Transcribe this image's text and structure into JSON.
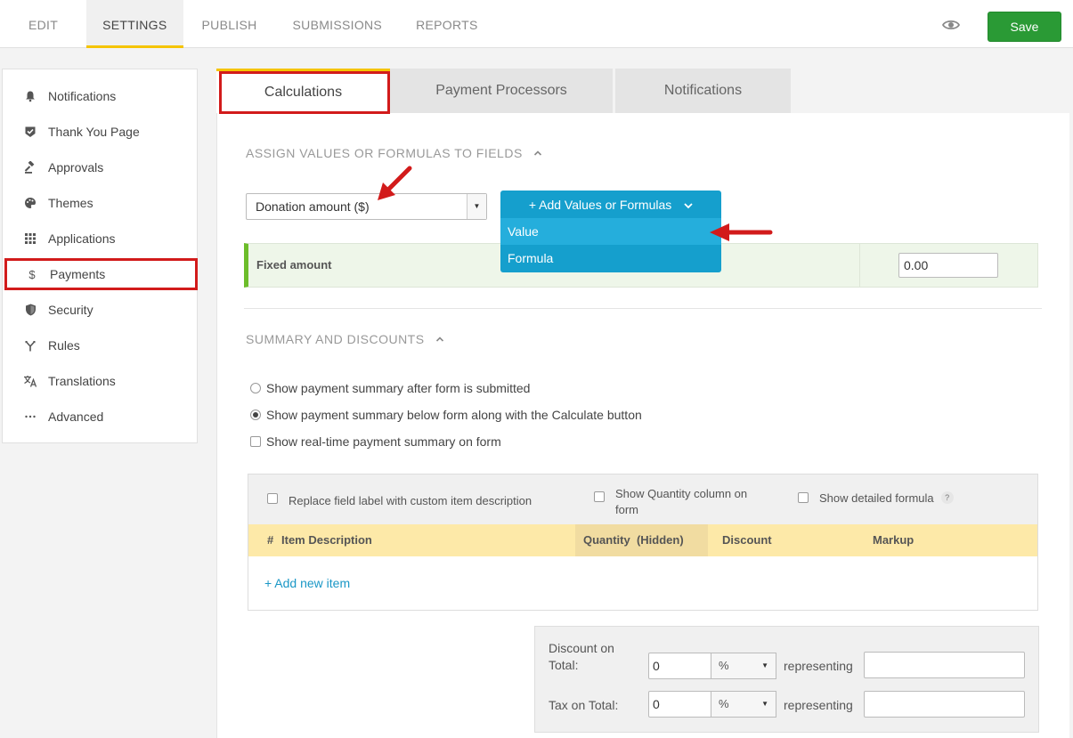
{
  "topnav": {
    "tabs": [
      "EDIT",
      "SETTINGS",
      "PUBLISH",
      "SUBMISSIONS",
      "REPORTS"
    ],
    "active_tab": "SETTINGS",
    "save_label": "Save"
  },
  "sidebar": {
    "items": [
      {
        "label": "Notifications",
        "icon": "bell-icon"
      },
      {
        "label": "Thank You Page",
        "icon": "badge-check-icon"
      },
      {
        "label": "Approvals",
        "icon": "gavel-icon"
      },
      {
        "label": "Themes",
        "icon": "palette-icon"
      },
      {
        "label": "Applications",
        "icon": "grid-icon"
      },
      {
        "label": "Payments",
        "icon": "dollar-icon"
      },
      {
        "label": "Security",
        "icon": "shield-icon"
      },
      {
        "label": "Rules",
        "icon": "fork-icon"
      },
      {
        "label": "Translations",
        "icon": "translate-icon"
      },
      {
        "label": "Advanced",
        "icon": "ellipsis-icon"
      }
    ],
    "active_item": "Payments"
  },
  "main_tabs": [
    "Calculations",
    "Payment Processors",
    "Notifications"
  ],
  "active_main_tab": "Calculations",
  "calculations": {
    "section_title": "ASSIGN VALUES OR FORMULAS TO FIELDS",
    "field_select_value": "Donation amount ($)",
    "add_button_label": "+ Add Values or Formulas",
    "dropdown_options": [
      "Value",
      "Formula"
    ],
    "fixed_amount_label": "Fixed amount",
    "fixed_amount_value": "0.00"
  },
  "summary": {
    "section_title": "SUMMARY AND DISCOUNTS",
    "options": [
      {
        "label": "Show payment summary after form is submitted",
        "type": "radio",
        "checked": false
      },
      {
        "label": "Show payment summary below form along with the Calculate button",
        "type": "radio",
        "checked": true
      },
      {
        "label": "Show real-time payment summary on form",
        "type": "checkbox",
        "checked": false
      }
    ],
    "table_options": {
      "replace_label": "Replace field label with custom item description",
      "show_quantity_line1": "Show Quantity column on",
      "show_quantity_line2": "form",
      "show_formula": "Show detailed formula",
      "help": "?"
    },
    "columns": {
      "hash": "#",
      "item": "Item Description",
      "quantity": "Quantity  (Hidden)",
      "discount": "Discount",
      "markup": "Markup"
    },
    "add_item_label": "+ Add new item"
  },
  "totals": {
    "discount_label_line1": "Discount on",
    "discount_label_line2": "Total:",
    "discount_value": "0",
    "discount_unit": "%",
    "tax_label": "Tax on Total:",
    "tax_value": "0",
    "tax_unit": "%",
    "representing_label": "representing",
    "discount_representing": "",
    "tax_representing": ""
  },
  "colors": {
    "accent_yellow": "#f5c400",
    "save_green": "#2a9a35",
    "dropdown_blue": "#159fcd",
    "highlight_red": "#d21b1b",
    "fixed_row_green": "#6cbd2a"
  }
}
